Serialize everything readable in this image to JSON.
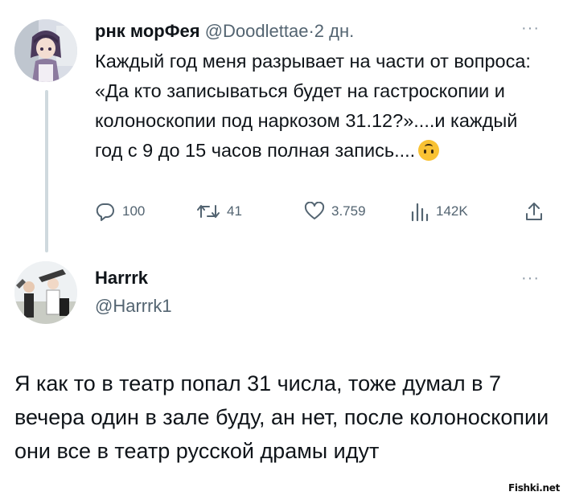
{
  "tweet1": {
    "author_name": "рнк морФея",
    "handle": "@Doodlettae",
    "separator": "·",
    "time": "2 дн.",
    "more": "···",
    "text": "Каждый год меня разрывает на части от вопроса: «Да кто записываться будет на гастроскопии и колоноскопии под наркозом 31.12?»....и каждый год с 9 до 15 часов полная запись....",
    "emoji": "upside-down-face",
    "actions": {
      "replies": "100",
      "retweets": "41",
      "likes": "3.759",
      "views": "142K"
    }
  },
  "tweet2": {
    "author_name": "Harrrk",
    "handle": "@Harrrk1",
    "more": "···",
    "text": "Я как то в театр попал 31 числа, тоже думал в 7 вечера один в зале буду, ан нет, после колоноскопии они все в театр русской драмы идут"
  },
  "watermark": "Fishki.net",
  "icons": {
    "reply": "reply-icon",
    "retweet": "retweet-icon",
    "like": "heart-icon",
    "views": "views-icon",
    "share": "share-icon"
  },
  "colors": {
    "text": "#0f1419",
    "secondary": "#536471",
    "thread_line": "#cfd9de"
  }
}
